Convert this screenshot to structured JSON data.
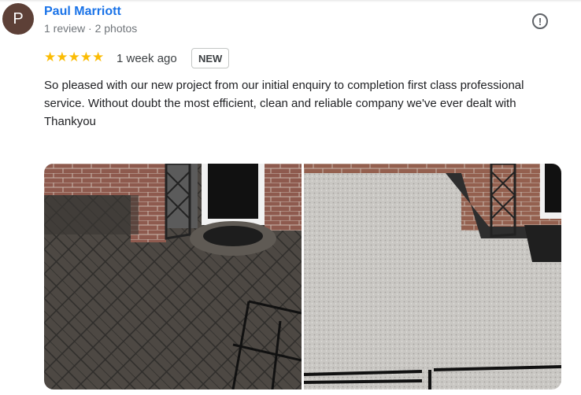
{
  "reviewer": {
    "initial": "P",
    "name": "Paul Marriott",
    "meta": "1 review · 2 photos"
  },
  "rating": {
    "stars": 5,
    "time": "1 week ago",
    "badge": "NEW"
  },
  "review": {
    "text": "So pleased with our new project from our initial enquiry to completion first class professional service. Without doubt the most efficient, clean and reliable company we've ever dealt with",
    "closing": "Thankyou"
  },
  "icons": {
    "report": "report-flag-icon"
  },
  "colors": {
    "accent": "#1a73e8",
    "star": "#fbbc04",
    "avatar": "#5d4037"
  },
  "photos": [
    {
      "name": "before-photo",
      "subject": "block paved patio"
    },
    {
      "name": "after-photo",
      "subject": "resin bound surface"
    }
  ]
}
